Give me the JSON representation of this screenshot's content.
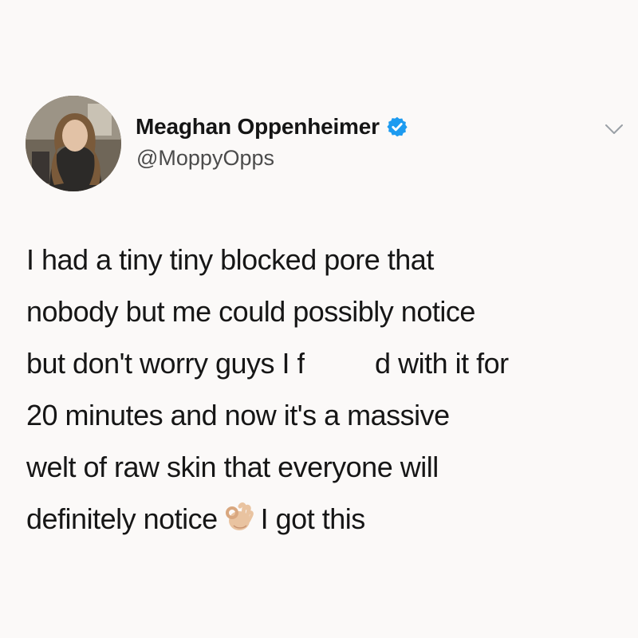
{
  "tweet": {
    "author": {
      "display_name": "Meaghan Oppenheimer",
      "handle": "@MoppyOpps",
      "verified": true,
      "verified_color": "#1d9bf0"
    },
    "menu_icon": "chevron-down-icon",
    "text_lines": [
      "I had a tiny tiny blocked pore that",
      "nobody but me could possibly notice",
      "but don't worry guys I f",
      "d with it for",
      "20 minutes and now it's a massive",
      "welt of raw skin that everyone will",
      "definitely notice",
      "I got this"
    ],
    "emoji": "ok-hand-emoji"
  }
}
